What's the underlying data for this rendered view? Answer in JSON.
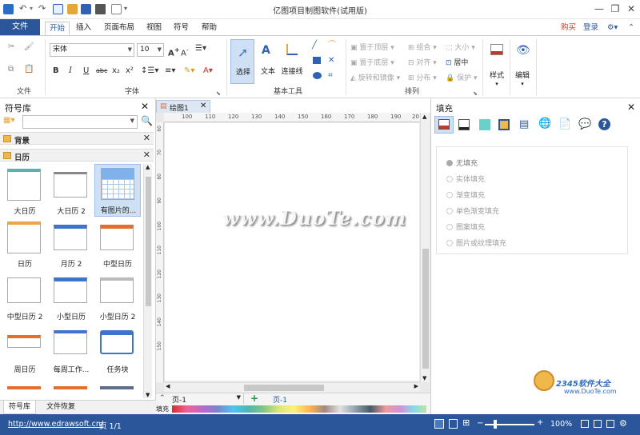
{
  "app": {
    "title": "亿图项目制图软件(试用版)",
    "accent": "#2b579a"
  },
  "titlebar": {
    "min": "—",
    "restore": "❐",
    "close": "✕",
    "restore_small": "▭"
  },
  "ribbon_tabs": {
    "file": "文件",
    "items": [
      "开始",
      "插入",
      "页面布局",
      "视图",
      "符号",
      "帮助"
    ],
    "buy": "购买",
    "login": "登录"
  },
  "ribbon": {
    "file_group_label": "文件",
    "font_name": "宋体",
    "font_size": "10",
    "font_group_label": "字体",
    "basic_tools_label": "基本工具",
    "select_label": "选择",
    "text_label": "文本",
    "connector_label": "连接线",
    "arrange_label": "排列",
    "arrange": {
      "bring_front": "置于顶层",
      "send_back": "置于底层",
      "rotate_mirror": "旋转和镜像",
      "group": "组合",
      "align": "对齐",
      "distribute": "分布",
      "size": "大小",
      "center": "居中",
      "protect": "保护"
    },
    "style_label": "样式",
    "edit_label": "编辑",
    "font_buttons": [
      "B",
      "I",
      "U",
      "abc",
      "x₂",
      "x²"
    ]
  },
  "left_panel": {
    "title": "符号库",
    "sections": [
      {
        "name": "背景"
      },
      {
        "name": "日历"
      }
    ],
    "items": [
      {
        "label": "大日历"
      },
      {
        "label": "大日历 2"
      },
      {
        "label": "有图片的..."
      },
      {
        "label": "日历"
      },
      {
        "label": "月历 2"
      },
      {
        "label": "中型日历"
      },
      {
        "label": "中型日历 2"
      },
      {
        "label": "小型日历"
      },
      {
        "label": "小型日历 2"
      },
      {
        "label": "周日历"
      },
      {
        "label": "每周工作..."
      },
      {
        "label": "任务块"
      }
    ],
    "bottom_tabs": [
      "符号库",
      "文件恢复"
    ]
  },
  "canvas": {
    "doc_tab": "绘图1",
    "ruler_h": [
      "100",
      "110",
      "120",
      "130",
      "140",
      "150",
      "160",
      "170",
      "180",
      "190",
      "20"
    ],
    "ruler_v": [
      "60",
      "70",
      "80",
      "90",
      "100",
      "110",
      "120",
      "130",
      "140",
      "150"
    ],
    "page_select": "页-1",
    "page_tab": "页-1",
    "fill_label": "填充",
    "add_page": "+"
  },
  "right_panel": {
    "title": "填充",
    "options": [
      "无填充",
      "实体填充",
      "渐变填充",
      "单色渐变填充",
      "图案填充",
      "图片或纹理填充"
    ]
  },
  "status": {
    "url": "http://www.edrawsoft.cn/",
    "page": "页 1/1",
    "zoom": "100%"
  },
  "watermark": {
    "text": "www.DuoTe.com",
    "corner1": "2345软件大全",
    "corner2": "www.DuoTe.com"
  }
}
